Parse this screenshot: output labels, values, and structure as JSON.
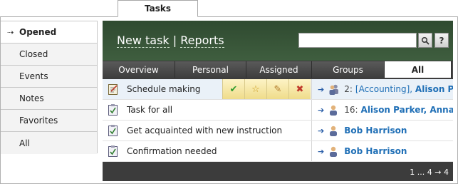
{
  "top_tab": {
    "label": "Tasks"
  },
  "sidebar": {
    "items": [
      {
        "label": "Opened",
        "active": true
      },
      {
        "label": "Closed"
      },
      {
        "label": "Events"
      },
      {
        "label": "Notes"
      },
      {
        "label": "Favorites"
      },
      {
        "label": "All"
      }
    ]
  },
  "header": {
    "new_task": "New task",
    "separator": " | ",
    "reports": "Reports",
    "search_placeholder": "",
    "help_label": "?"
  },
  "tabs": [
    {
      "label": "Overview"
    },
    {
      "label": "Personal"
    },
    {
      "label": "Assigned"
    },
    {
      "label": "Groups"
    },
    {
      "label": "All",
      "active": true
    }
  ],
  "tasks": [
    {
      "title": "Schedule making",
      "num": "2:",
      "group": "[Accounting],",
      "assignee": "Alison Pa"
    },
    {
      "title": "Task for all",
      "num": "16:",
      "group": "",
      "assignee": "Alison Parker, Anna N"
    },
    {
      "title": "Get acquainted with new instruction",
      "num": "",
      "group": "",
      "assignee": "Bob Harrison"
    },
    {
      "title": "Confirmation needed",
      "num": "",
      "group": "",
      "assignee": "Bob Harrison"
    }
  ],
  "pager": "1 ... 4 → 4",
  "colors": {
    "header_green": "#3f5e3f",
    "link_blue": "#1f6fb6",
    "footer_gray": "#3c3c3c"
  }
}
